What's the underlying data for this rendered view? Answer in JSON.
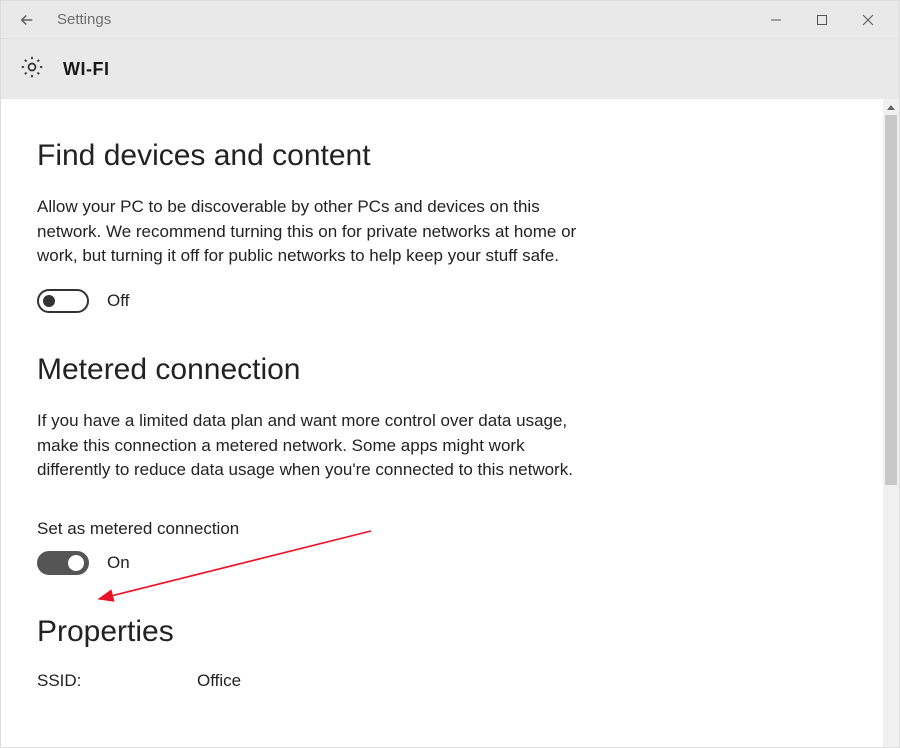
{
  "titlebar": {
    "app_title": "Settings"
  },
  "header": {
    "page_title": "WI-FI"
  },
  "sections": {
    "find_devices": {
      "heading": "Find devices and content",
      "description": "Allow your PC to be discoverable by other PCs and devices on this network. We recommend turning this on for private networks at home or work, but turning it off for public networks to help keep your stuff safe.",
      "toggle_state": "Off"
    },
    "metered": {
      "heading": "Metered connection",
      "description": "If you have a limited data plan and want more control over data usage, make this connection a metered network. Some apps might work differently to reduce data usage when you're connected to this network.",
      "sub_label": "Set as metered connection",
      "toggle_state": "On"
    },
    "properties": {
      "heading": "Properties",
      "ssid_label": "SSID:",
      "ssid_value": "Office"
    }
  }
}
